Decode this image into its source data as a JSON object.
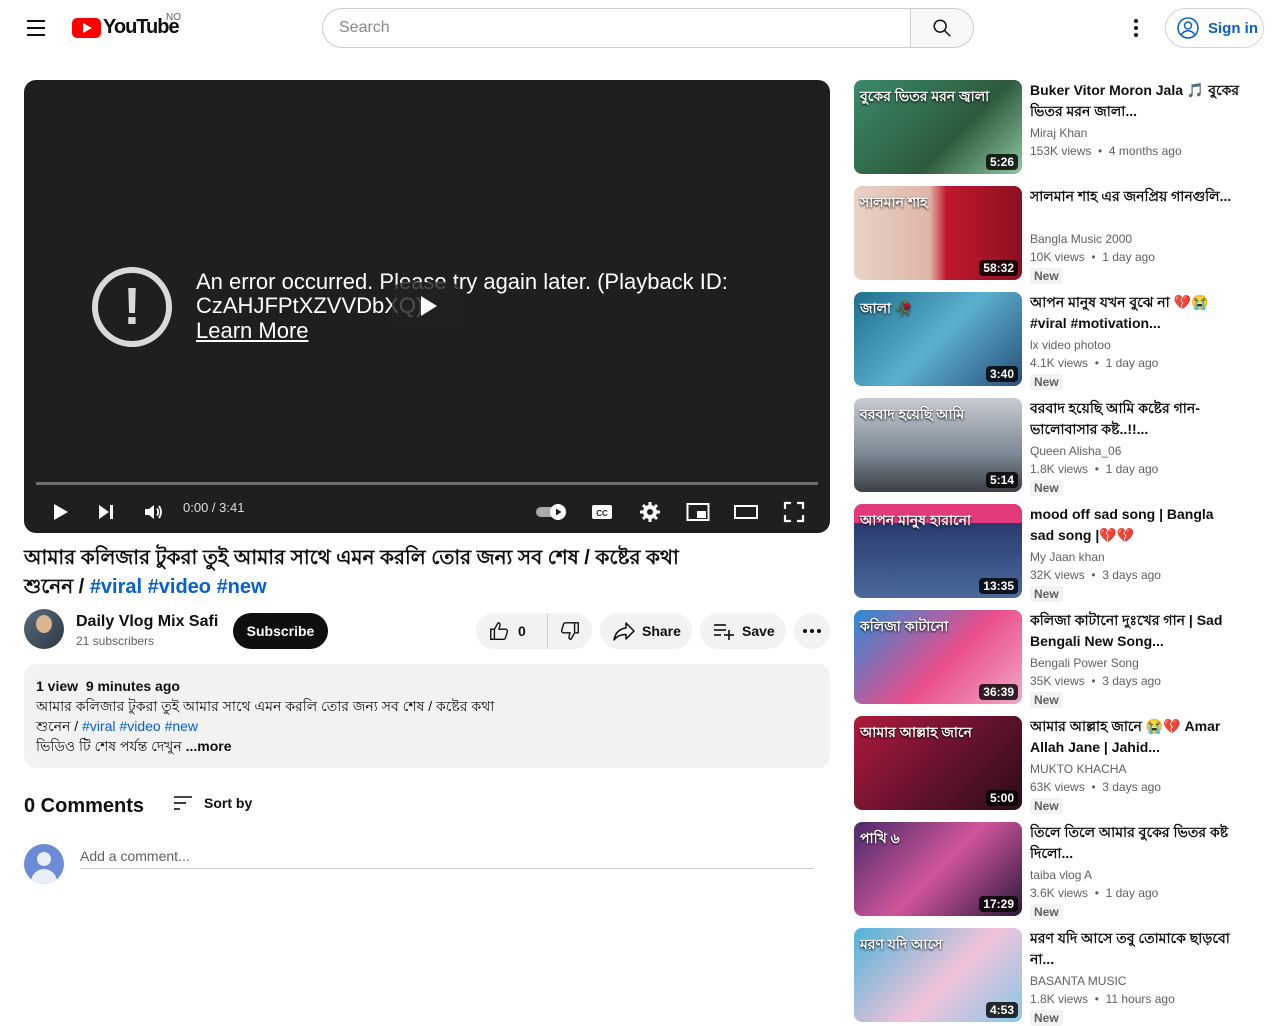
{
  "header": {
    "logo_text": "YouTube",
    "country": "NO",
    "search_placeholder": "Search",
    "sign_in": "Sign in"
  },
  "player": {
    "error_message": "An error occurred. Please try again later. (Playback ID: CzAHJFPtXZVVDbXQ)",
    "learn_more": "Learn More",
    "time": "0:00 / 3:41"
  },
  "video": {
    "title_prefix": "আমার কলিজার টুকরা তুই আমার সাথে এমন করলি তোর জন্য সব শেষ / কষ্টের কথা",
    "title_suffix": "শুনেন /",
    "tags": [
      "#viral",
      "#video",
      "#new"
    ],
    "channel": "Daily Vlog Mix Safi",
    "subscribers": "21 subscribers",
    "subscribe": "Subscribe",
    "likes": "0",
    "share": "Share",
    "save": "Save"
  },
  "description": {
    "views": "1 view",
    "age": "9 minutes ago",
    "line1": "আমার কলিজার টুকরা তুই আমার সাথে এমন করলি তোর জন্য সব শেষ / কষ্টের কথা",
    "line2_prefix": "শুনেন /",
    "line3": "ভিডিও টি শেষ পর্যন্ত দেখুন",
    "more": "...more"
  },
  "comments": {
    "count": "0 Comments",
    "sort": "Sort by",
    "placeholder": "Add a comment..."
  },
  "recommendations": [
    {
      "title": "Buker Vitor Moron Jala 🎵 বুকের ভিতর মরন জালা...",
      "channel": "Miraj Khan",
      "views": "153K views",
      "age": "4 months ago",
      "duration": "5:26",
      "badge": "",
      "thumb_text": "বুকের ভিতর মরন জ্বালা"
    },
    {
      "title": "সালমান শাহ এর জনপ্রিয় গানগুলি...",
      "channel": "Bangla Music 2000",
      "views": "10K views",
      "age": "1 day ago",
      "duration": "58:32",
      "badge": "New",
      "thumb_text": "সালমান শাহ"
    },
    {
      "title": "আপন মানুষ যখন বুঝে না 💔😭#viral #motivation...",
      "channel": "lx video photoo",
      "views": "4.1K views",
      "age": "1 day ago",
      "duration": "3:40",
      "badge": "New",
      "thumb_text": "জালা 🥀"
    },
    {
      "title": "বরবাদ হয়েছি আমি কষ্টের গান-ভালোবাসার কষ্ট..!!...",
      "channel": "Queen Alisha_06",
      "views": "1.8K views",
      "age": "1 day ago",
      "duration": "5:14",
      "badge": "New",
      "thumb_text": "বরবাদ হয়েছি আমি"
    },
    {
      "title": "mood off sad song | Bangla sad song |💔💔",
      "channel": "My Jaan khan",
      "views": "32K views",
      "age": "3 days ago",
      "duration": "13:35",
      "badge": "New",
      "thumb_text": "আপন মানুষ হারানো"
    },
    {
      "title": "কলিজা কাটানো দুঃখের গান | Sad Bengali New Song...",
      "channel": "Bengali Power Song",
      "views": "35K views",
      "age": "3 days ago",
      "duration": "36:39",
      "badge": "New",
      "thumb_text": "কলিজা কাটানো"
    },
    {
      "title": "আমার আল্লাহ জানে 😭💔 Amar Allah Jane | Jahid...",
      "channel": "MUKTO KHACHA",
      "views": "63K views",
      "age": "3 days ago",
      "duration": "5:00",
      "badge": "New",
      "thumb_text": "আমার আল্লাহ জানে"
    },
    {
      "title": "তিলে তিলে আমার বুকের ভিতর কষ্ট দিলো...",
      "channel": "taiba vlog A",
      "views": "3.6K views",
      "age": "1 day ago",
      "duration": "17:29",
      "badge": "New",
      "thumb_text": "পাখি ৬"
    },
    {
      "title": "মরণ যদি আসে তবু তোমাকে ছাড়বো না...",
      "channel": "BASANTA MUSIC",
      "views": "1.8K views",
      "age": "11 hours ago",
      "duration": "4:53",
      "badge": "New",
      "thumb_text": "মরণ যদি আসে"
    }
  ],
  "colors": {
    "brand": "#ff0000",
    "link": "#065fd4",
    "player_bg": "#1f1f1f"
  }
}
